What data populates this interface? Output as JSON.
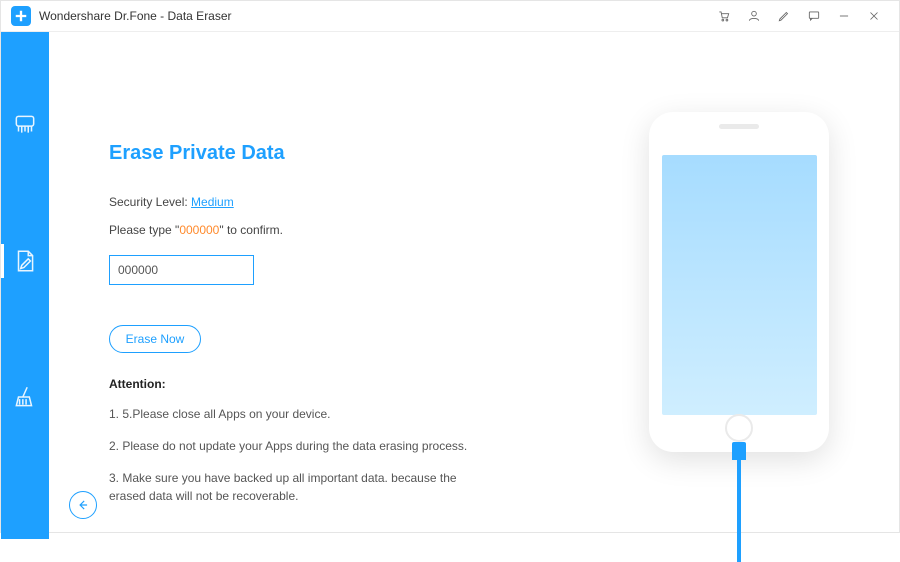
{
  "app": {
    "title": "Wondershare Dr.Fone - Data Eraser"
  },
  "main": {
    "heading": "Erase Private Data",
    "security_label": "Security Level: ",
    "security_value": "Medium",
    "confirm_prefix": "Please type \"",
    "confirm_code": "000000",
    "confirm_suffix": "\" to confirm.",
    "input_value": "000000",
    "erase_button": "Erase Now"
  },
  "attention": {
    "title": "Attention:",
    "items": [
      "1. 5.Please close all Apps on your device.",
      "2. Please do not update your Apps during the data erasing process.",
      "3. Make sure you have backed up all important data. because the erased data will not be recoverable."
    ]
  }
}
